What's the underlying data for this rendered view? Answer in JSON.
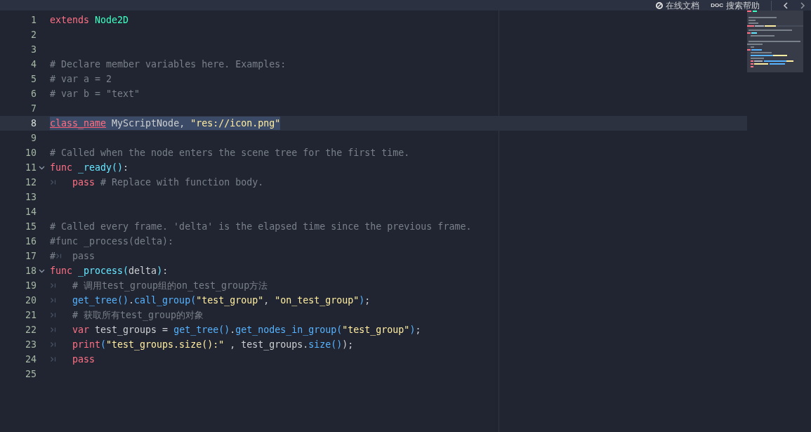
{
  "toolbar": {
    "buttons": [
      {
        "kind": "online",
        "label": "在线文档"
      },
      {
        "kind": "search",
        "icon_text": "DOC",
        "label": "搜索帮助"
      }
    ]
  },
  "editor": {
    "lines": [
      {
        "number": "1",
        "foldable": false,
        "current": false,
        "segments": [
          {
            "kind": "code",
            "tokens": [
              {
                "kind": "keyword",
                "text": "extends "
              },
              {
                "kind": "type",
                "text": "Node2D"
              }
            ]
          }
        ]
      },
      {
        "number": "2",
        "foldable": false,
        "current": false
      },
      {
        "number": "3",
        "foldable": false,
        "current": false
      },
      {
        "number": "4",
        "foldable": false,
        "current": false,
        "segments": [
          {
            "kind": "code",
            "tokens": [
              {
                "kind": "comment",
                "text": "# Declare member variables here. Examples:"
              }
            ]
          }
        ]
      },
      {
        "number": "5",
        "foldable": false,
        "current": false,
        "segments": [
          {
            "kind": "code",
            "tokens": [
              {
                "kind": "comment",
                "text": "# var a = 2"
              }
            ]
          }
        ]
      },
      {
        "number": "6",
        "foldable": false,
        "current": false,
        "segments": [
          {
            "kind": "code",
            "tokens": [
              {
                "kind": "comment",
                "text": "# var b = \"text\""
              }
            ]
          }
        ]
      },
      {
        "number": "7",
        "foldable": false,
        "current": false
      },
      {
        "number": "8",
        "foldable": false,
        "current": true,
        "segments": [
          {
            "kind": "code",
            "tokens": [
              {
                "kind": "keyword-underlined",
                "text": "class_name"
              },
              {
                "kind": "plain",
                "text": " MyScriptNode, "
              },
              {
                "kind": "string",
                "text": "\"res://icon.png\""
              }
            ]
          }
        ]
      },
      {
        "number": "9",
        "foldable": false,
        "current": false
      },
      {
        "number": "10",
        "foldable": false,
        "current": false,
        "segments": [
          {
            "kind": "code",
            "tokens": [
              {
                "kind": "comment",
                "text": "# Called when the node enters the scene tree for the first time."
              }
            ]
          }
        ]
      },
      {
        "number": "11",
        "foldable": true,
        "current": false,
        "segments": [
          {
            "kind": "code",
            "tokens": [
              {
                "kind": "keyword",
                "text": "func "
              },
              {
                "kind": "func",
                "text": "_ready()"
              },
              {
                "kind": "plain",
                "text": ":"
              }
            ]
          }
        ]
      },
      {
        "number": "12",
        "foldable": false,
        "current": false,
        "segments": [
          {
            "kind": "tab"
          },
          {
            "kind": "code",
            "tokens": [
              {
                "kind": "keyword",
                "text": "pass"
              },
              {
                "kind": "comment",
                "text": " # Replace with function body."
              }
            ]
          }
        ]
      },
      {
        "number": "13",
        "foldable": false,
        "current": false
      },
      {
        "number": "14",
        "foldable": false,
        "current": false
      },
      {
        "number": "15",
        "foldable": false,
        "current": false,
        "segments": [
          {
            "kind": "code",
            "tokens": [
              {
                "kind": "comment",
                "text": "# Called every frame. 'delta' is the elapsed time since the previous frame."
              }
            ]
          }
        ]
      },
      {
        "number": "16",
        "foldable": false,
        "current": false,
        "segments": [
          {
            "kind": "code",
            "tokens": [
              {
                "kind": "comment",
                "text": "#func _process(delta):"
              }
            ]
          }
        ]
      },
      {
        "number": "17",
        "foldable": false,
        "current": false,
        "segments": [
          {
            "kind": "code",
            "tokens": [
              {
                "kind": "comment",
                "text": "#"
              }
            ]
          },
          {
            "kind": "tab"
          },
          {
            "kind": "code",
            "tokens": [
              {
                "kind": "comment",
                "text": "pass"
              }
            ]
          }
        ]
      },
      {
        "number": "18",
        "foldable": true,
        "current": false,
        "segments": [
          {
            "kind": "code",
            "tokens": [
              {
                "kind": "keyword",
                "text": "func "
              },
              {
                "kind": "func",
                "text": "_process("
              },
              {
                "kind": "plain",
                "text": "delta"
              },
              {
                "kind": "func",
                "text": ")"
              },
              {
                "kind": "plain",
                "text": ":"
              }
            ]
          }
        ]
      },
      {
        "number": "19",
        "foldable": false,
        "current": false,
        "segments": [
          {
            "kind": "tab"
          },
          {
            "kind": "code",
            "tokens": [
              {
                "kind": "comment",
                "text": "# 调用test_group组的on_test_group方法"
              }
            ]
          }
        ]
      },
      {
        "number": "20",
        "foldable": false,
        "current": false,
        "segments": [
          {
            "kind": "tab"
          },
          {
            "kind": "code",
            "tokens": [
              {
                "kind": "method",
                "text": "get_tree()"
              },
              {
                "kind": "plain",
                "text": "."
              },
              {
                "kind": "method",
                "text": "call_group("
              },
              {
                "kind": "string",
                "text": "\"test_group\""
              },
              {
                "kind": "plain",
                "text": ", "
              },
              {
                "kind": "string",
                "text": "\"on_test_group\""
              },
              {
                "kind": "method",
                "text": ")"
              },
              {
                "kind": "plain",
                "text": ";"
              }
            ]
          }
        ]
      },
      {
        "number": "21",
        "foldable": false,
        "current": false,
        "segments": [
          {
            "kind": "tab"
          },
          {
            "kind": "code",
            "tokens": [
              {
                "kind": "comment",
                "text": "# 获取所有test_group的对象"
              }
            ]
          }
        ]
      },
      {
        "number": "22",
        "foldable": false,
        "current": false,
        "segments": [
          {
            "kind": "tab"
          },
          {
            "kind": "code",
            "tokens": [
              {
                "kind": "keyword",
                "text": "var"
              },
              {
                "kind": "plain",
                "text": " test_groups = "
              },
              {
                "kind": "method",
                "text": "get_tree()"
              },
              {
                "kind": "plain",
                "text": "."
              },
              {
                "kind": "method",
                "text": "get_nodes_in_group("
              },
              {
                "kind": "string",
                "text": "\"test_group\""
              },
              {
                "kind": "method",
                "text": ")"
              },
              {
                "kind": "plain",
                "text": ";"
              }
            ]
          }
        ]
      },
      {
        "number": "23",
        "foldable": false,
        "current": false,
        "segments": [
          {
            "kind": "tab"
          },
          {
            "kind": "code",
            "tokens": [
              {
                "kind": "keyword",
                "text": "print"
              },
              {
                "kind": "method",
                "text": "("
              },
              {
                "kind": "string",
                "text": "\"test_groups.size():\""
              },
              {
                "kind": "plain",
                "text": " , test_groups."
              },
              {
                "kind": "method",
                "text": "size()"
              },
              {
                "kind": "plain",
                "text": ");"
              }
            ]
          }
        ]
      },
      {
        "number": "24",
        "foldable": false,
        "current": false,
        "segments": [
          {
            "kind": "tab"
          },
          {
            "kind": "code",
            "tokens": [
              {
                "kind": "keyword",
                "text": "pass"
              }
            ]
          }
        ]
      },
      {
        "number": "25",
        "foldable": false,
        "current": false
      }
    ]
  }
}
